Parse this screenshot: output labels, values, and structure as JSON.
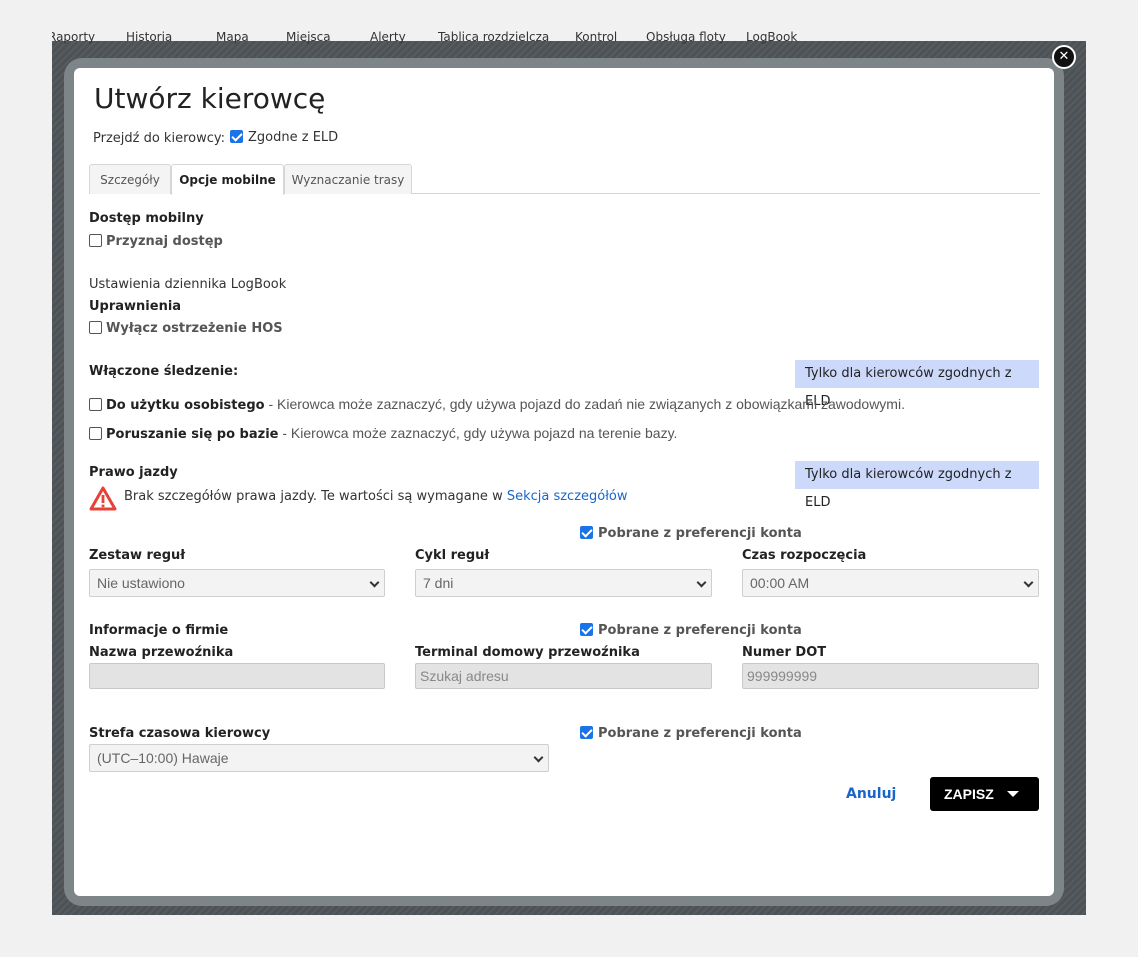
{
  "top_nav": [
    "Raporty",
    "Historia",
    "Mapa",
    "Miejsca",
    "Alerty",
    "Tablica rozdzielcza",
    "Kontrol",
    "Obsługa floty",
    "LogBook"
  ],
  "icons": {
    "close": "close-icon",
    "warning": "warning-triangle-icon",
    "chevron": "chevron-down-icon",
    "caret": "caret-down-icon"
  },
  "colors": {
    "accent": "#1a73e8",
    "link": "#1a66c8",
    "badge_bg": "#cdd9fa",
    "warning": "#e8413a",
    "save_bg": "#000000"
  },
  "modal": {
    "title": "Utwórz kierowcę",
    "goto_label": "Przejdź do kierowcy:",
    "eld_label": "Zgodne z ELD",
    "eld_checked": true
  },
  "tabs": [
    {
      "label": "Szczegóły",
      "active": false
    },
    {
      "label": "Opcje mobilne",
      "active": true
    },
    {
      "label": "Wyznaczanie trasy",
      "active": false
    }
  ],
  "mobile_access": {
    "title": "Dostęp mobilny",
    "grant_label": "Przyznaj dostęp",
    "grant_checked": false
  },
  "logbook": {
    "settings_label": "Ustawienia dziennika LogBook",
    "permissions_title": "Uprawnienia",
    "hos_label": "Wyłącz ostrzeżenie HOS",
    "hos_checked": false
  },
  "tracking": {
    "title": "Włączone śledzenie:",
    "badge": "Tylko dla kierowców zgodnych z ELD",
    "personal_label": "Do użytku osobistego",
    "personal_desc": " - Kierowca może zaznaczyć, gdy używa pojazd do zadań nie związanych z obowiązkami zawodowymi.",
    "yard_label": "Poruszanie się po bazie",
    "yard_desc": " - Kierowca może zaznaczyć, gdy używa pojazd na terenie bazy."
  },
  "license": {
    "title": "Prawo jazdy",
    "badge": "Tylko dla kierowców zgodnych z ELD",
    "warning_text": "Brak szczegółów prawa jazdy. Te wartości są wymagane w ",
    "warning_link": "Sekcja szczegółów"
  },
  "rules": {
    "pref_label": "Pobrane z preferencji konta",
    "pref_checked": true,
    "ruleset_label": "Zestaw reguł",
    "ruleset_value": "Nie ustawiono",
    "cycle_label": "Cykl reguł",
    "cycle_value": "7 dni",
    "start_label": "Czas rozpoczęcia",
    "start_value": "00:00 AM"
  },
  "company": {
    "title": "Informacje o firmie",
    "pref_label": "Pobrane z preferencji konta",
    "pref_checked": true,
    "carrier_label": "Nazwa przewoźnika",
    "carrier_value": "",
    "terminal_label": "Terminal domowy przewoźnika",
    "terminal_placeholder": "Szukaj adresu",
    "dot_label": "Numer DOT",
    "dot_value": "999999999"
  },
  "timezone": {
    "label": "Strefa czasowa kierowcy",
    "value": "(UTC–10:00) Hawaje",
    "pref_label": "Pobrane z preferencji konta",
    "pref_checked": true
  },
  "actions": {
    "cancel": "Anuluj",
    "save": "ZAPISZ"
  }
}
